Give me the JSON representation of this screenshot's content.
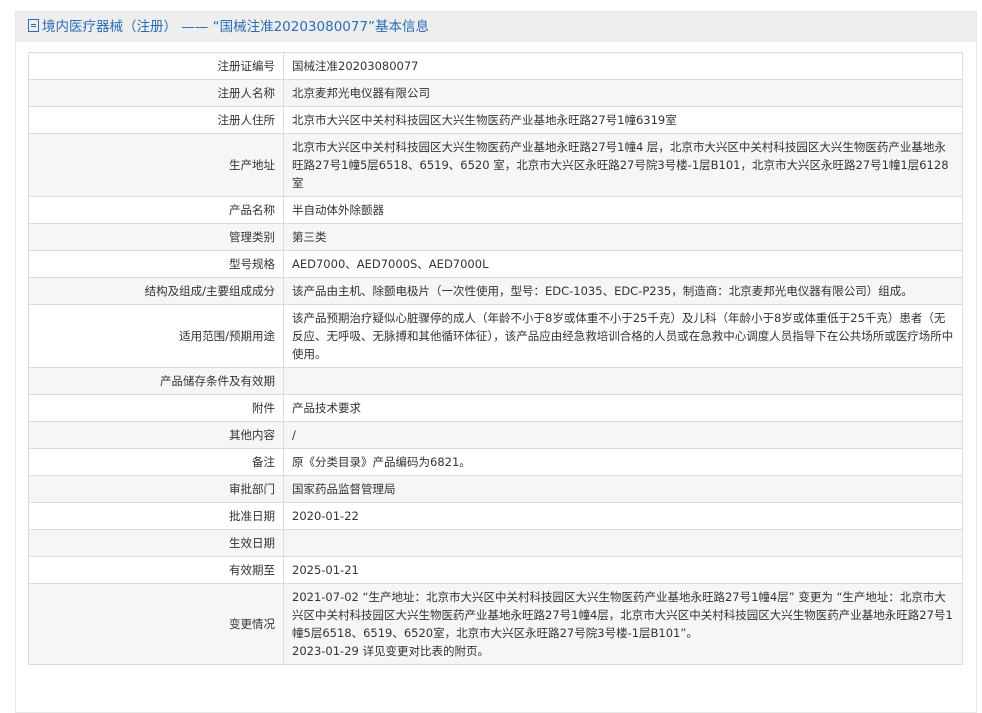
{
  "header": {
    "title": "境内医疗器械（注册） —— “国械注准20203080077”基本信息"
  },
  "rows": [
    {
      "label": "注册证编号",
      "value": "国械注准20203080077"
    },
    {
      "label": "注册人名称",
      "value": "北京麦邦光电仪器有限公司"
    },
    {
      "label": "注册人住所",
      "value": "北京市大兴区中关村科技园区大兴生物医药产业基地永旺路27号1幢6319室"
    },
    {
      "label": "生产地址",
      "value": "北京市大兴区中关村科技园区大兴生物医药产业基地永旺路27号1幢4 层，北京市大兴区中关村科技园区大兴生物医药产业基地永旺路27号1幢5层6518、6519、6520 室，北京市大兴区永旺路27号院3号楼-1层B101，北京市大兴区永旺路27号1幢1层6128室"
    },
    {
      "label": "产品名称",
      "value": "半自动体外除颤器"
    },
    {
      "label": "管理类别",
      "value": "第三类"
    },
    {
      "label": "型号规格",
      "value": "AED7000、AED7000S、AED7000L"
    },
    {
      "label": "结构及组成/主要组成成分",
      "value": "该产品由主机、除颤电极片（一次性使用，型号：EDC-1035、EDC-P235，制造商：北京麦邦光电仪器有限公司）组成。"
    },
    {
      "label": "适用范围/预期用途",
      "value": "该产品预期治疗疑似心脏骤停的成人（年龄不小于8岁或体重不小于25千克）及儿科（年龄小于8岁或体重低于25千克）患者（无反应、无呼吸、无脉搏和其他循环体征），该产品应由经急救培训合格的人员或在急救中心调度人员指导下在公共场所或医疗场所中使用。"
    },
    {
      "label": "产品储存条件及有效期",
      "value": ""
    },
    {
      "label": "附件",
      "value": "产品技术要求"
    },
    {
      "label": "其他内容",
      "value": "/"
    },
    {
      "label": "备注",
      "value": "原《分类目录》产品编码为6821。"
    },
    {
      "label": "审批部门",
      "value": "国家药品监督管理局"
    },
    {
      "label": "批准日期",
      "value": "2020-01-22"
    },
    {
      "label": "生效日期",
      "value": ""
    },
    {
      "label": "有效期至",
      "value": "2025-01-21"
    },
    {
      "label": "变更情况",
      "value": "2021-07-02 “生产地址：北京市大兴区中关村科技园区大兴生物医药产业基地永旺路27号1幢4层” 变更为 “生产地址：北京市大兴区中关村科技园区大兴生物医药产业基地永旺路27号1幢4层，北京市大兴区中关村科技园区大兴生物医药产业基地永旺路27号1幢5层6518、6519、6520室，北京市大兴区永旺路27号院3号楼-1层B101”。",
      "value2": "2023-01-29 详见变更对比表的附页。"
    }
  ]
}
